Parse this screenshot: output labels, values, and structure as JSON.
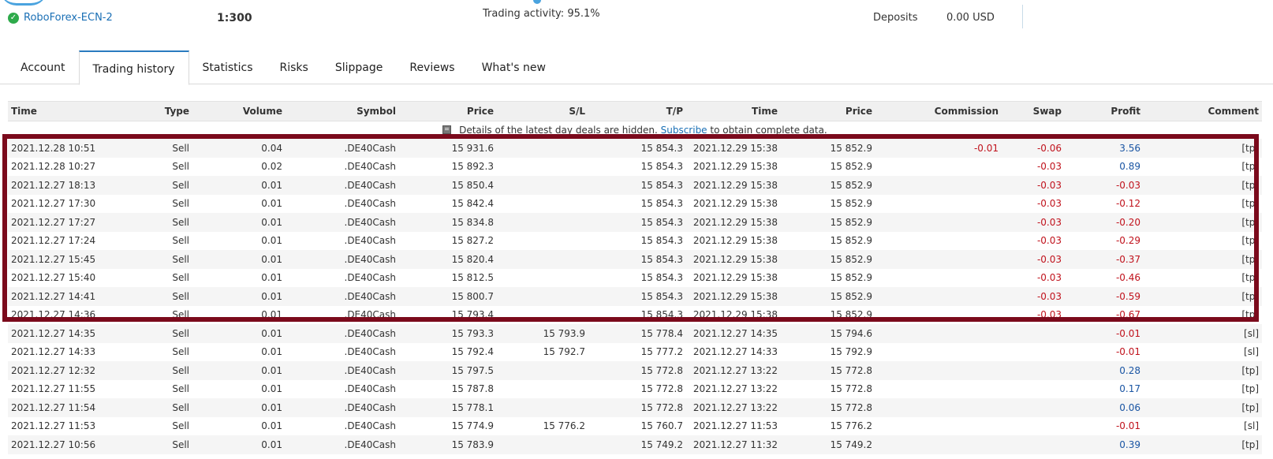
{
  "header": {
    "account_name": "RoboForex-ECN-2",
    "leverage": "1:300",
    "trading_activity_label": "Trading activity:",
    "trading_activity_value": "95.1%",
    "deposits_label": "Deposits",
    "deposits_value": "0.00 USD"
  },
  "tabs": [
    {
      "label": "Account",
      "active": false
    },
    {
      "label": "Trading history",
      "active": true
    },
    {
      "label": "Statistics",
      "active": false
    },
    {
      "label": "Risks",
      "active": false
    },
    {
      "label": "Slippage",
      "active": false
    },
    {
      "label": "Reviews",
      "active": false
    },
    {
      "label": "What's new",
      "active": false
    }
  ],
  "table": {
    "columns": [
      "Time",
      "Type",
      "Volume",
      "Symbol",
      "Price",
      "S/L",
      "T/P",
      "Time",
      "Price",
      "Commission",
      "Swap",
      "Profit",
      "Comment"
    ],
    "notice": {
      "before": "Details of the latest day deals are hidden.",
      "link": "Subscribe",
      "after": "to obtain complete data."
    },
    "rows": [
      [
        "2021.12.28 10:51",
        "Sell",
        "0.04",
        ".DE40Cash",
        "15 931.6",
        "",
        "15 854.3",
        "2021.12.29 15:38",
        "15 852.9",
        "-0.01",
        "-0.06",
        "3.56",
        "[tp]"
      ],
      [
        "2021.12.28 10:27",
        "Sell",
        "0.02",
        ".DE40Cash",
        "15 892.3",
        "",
        "15 854.3",
        "2021.12.29 15:38",
        "15 852.9",
        "",
        "-0.03",
        "0.89",
        "[tp]"
      ],
      [
        "2021.12.27 18:13",
        "Sell",
        "0.01",
        ".DE40Cash",
        "15 850.4",
        "",
        "15 854.3",
        "2021.12.29 15:38",
        "15 852.9",
        "",
        "-0.03",
        "-0.03",
        "[tp]"
      ],
      [
        "2021.12.27 17:30",
        "Sell",
        "0.01",
        ".DE40Cash",
        "15 842.4",
        "",
        "15 854.3",
        "2021.12.29 15:38",
        "15 852.9",
        "",
        "-0.03",
        "-0.12",
        "[tp]"
      ],
      [
        "2021.12.27 17:27",
        "Sell",
        "0.01",
        ".DE40Cash",
        "15 834.8",
        "",
        "15 854.3",
        "2021.12.29 15:38",
        "15 852.9",
        "",
        "-0.03",
        "-0.20",
        "[tp]"
      ],
      [
        "2021.12.27 17:24",
        "Sell",
        "0.01",
        ".DE40Cash",
        "15 827.2",
        "",
        "15 854.3",
        "2021.12.29 15:38",
        "15 852.9",
        "",
        "-0.03",
        "-0.29",
        "[tp]"
      ],
      [
        "2021.12.27 15:45",
        "Sell",
        "0.01",
        ".DE40Cash",
        "15 820.4",
        "",
        "15 854.3",
        "2021.12.29 15:38",
        "15 852.9",
        "",
        "-0.03",
        "-0.37",
        "[tp]"
      ],
      [
        "2021.12.27 15:40",
        "Sell",
        "0.01",
        ".DE40Cash",
        "15 812.5",
        "",
        "15 854.3",
        "2021.12.29 15:38",
        "15 852.9",
        "",
        "-0.03",
        "-0.46",
        "[tp]"
      ],
      [
        "2021.12.27 14:41",
        "Sell",
        "0.01",
        ".DE40Cash",
        "15 800.7",
        "",
        "15 854.3",
        "2021.12.29 15:38",
        "15 852.9",
        "",
        "-0.03",
        "-0.59",
        "[tp]"
      ],
      [
        "2021.12.27 14:36",
        "Sell",
        "0.01",
        ".DE40Cash",
        "15 793.4",
        "",
        "15 854.3",
        "2021.12.29 15:38",
        "15 852.9",
        "",
        "-0.03",
        "-0.67",
        "[tp]"
      ],
      [
        "2021.12.27 14:35",
        "Sell",
        "0.01",
        ".DE40Cash",
        "15 793.3",
        "15 793.9",
        "15 778.4",
        "2021.12.27 14:35",
        "15 794.6",
        "",
        "",
        "-0.01",
        "[sl]"
      ],
      [
        "2021.12.27 14:33",
        "Sell",
        "0.01",
        ".DE40Cash",
        "15 792.4",
        "15 792.7",
        "15 777.2",
        "2021.12.27 14:33",
        "15 792.9",
        "",
        "",
        "-0.01",
        "[sl]"
      ],
      [
        "2021.12.27 12:32",
        "Sell",
        "0.01",
        ".DE40Cash",
        "15 797.5",
        "",
        "15 772.8",
        "2021.12.27 13:22",
        "15 772.8",
        "",
        "",
        "0.28",
        "[tp]"
      ],
      [
        "2021.12.27 11:55",
        "Sell",
        "0.01",
        ".DE40Cash",
        "15 787.8",
        "",
        "15 772.8",
        "2021.12.27 13:22",
        "15 772.8",
        "",
        "",
        "0.17",
        "[tp]"
      ],
      [
        "2021.12.27 11:54",
        "Sell",
        "0.01",
        ".DE40Cash",
        "15 778.1",
        "",
        "15 772.8",
        "2021.12.27 13:22",
        "15 772.8",
        "",
        "",
        "0.06",
        "[tp]"
      ],
      [
        "2021.12.27 11:53",
        "Sell",
        "0.01",
        ".DE40Cash",
        "15 774.9",
        "15 776.2",
        "15 760.7",
        "2021.12.27 11:53",
        "15 776.2",
        "",
        "",
        "-0.01",
        "[sl]"
      ],
      [
        "2021.12.27 10:56",
        "Sell",
        "0.01",
        ".DE40Cash",
        "15 783.9",
        "",
        "15 749.2",
        "2021.12.27 11:32",
        "15 749.2",
        "",
        "",
        "0.39",
        "[tp]"
      ]
    ]
  },
  "colors": {
    "accent": "#1a6fb5",
    "negative": "#c0121c",
    "positive": "#1a55a3",
    "highlight_border": "#7b0a1c",
    "status_ok": "#2eaa4b"
  }
}
